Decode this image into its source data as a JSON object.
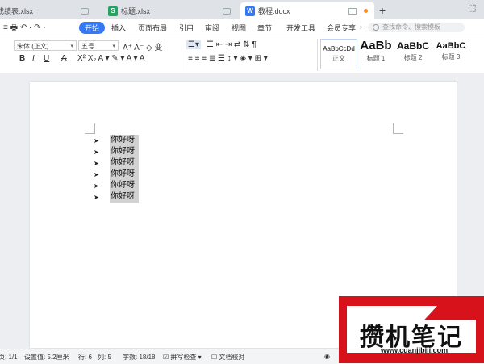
{
  "tabs": [
    {
      "label": "成绩表.xlsx",
      "icon": "sheet-icon",
      "color": "#22a463"
    },
    {
      "label": "标题.xlsx",
      "icon": "sheet-icon",
      "color": "#22a463"
    },
    {
      "label": "教程.docx",
      "icon": "writer-icon",
      "color": "#3478f6",
      "active": true
    }
  ],
  "new_tab": "+",
  "menu": {
    "items": [
      "开始",
      "插入",
      "页面布局",
      "引用",
      "审阅",
      "视图",
      "章节",
      "开发工具",
      "会员专享"
    ],
    "more": "›",
    "search_placeholder": "查找命令、搜索模板"
  },
  "ribbon": {
    "font_name": "宋体 (正文)",
    "font_size": "五号",
    "style_samples": [
      {
        "sample": "AaBbCcDd",
        "label": "正文"
      },
      {
        "sample": "AaBb",
        "label": "标题 1"
      },
      {
        "sample": "AaBbC",
        "label": "标题 2"
      },
      {
        "sample": "AaBbC",
        "label": "标题 3"
      }
    ],
    "bold": "B",
    "italic": "I",
    "underline": "U",
    "strike": "A"
  },
  "document": {
    "bullet": "➤",
    "items": [
      "你好呀",
      "你好呀",
      "你好呀",
      "你好呀",
      "你好呀",
      "你好呀"
    ]
  },
  "status": {
    "page": "页: 1/1",
    "setting": "设置值: 5.2厘米",
    "line": "行: 6",
    "col": "列: 5",
    "words": "字数: 18/18",
    "spell": "拼写检查",
    "proof": "文档校对"
  },
  "watermark": {
    "title": "攒机笔记",
    "url": "www.cuanjibiji.com"
  }
}
